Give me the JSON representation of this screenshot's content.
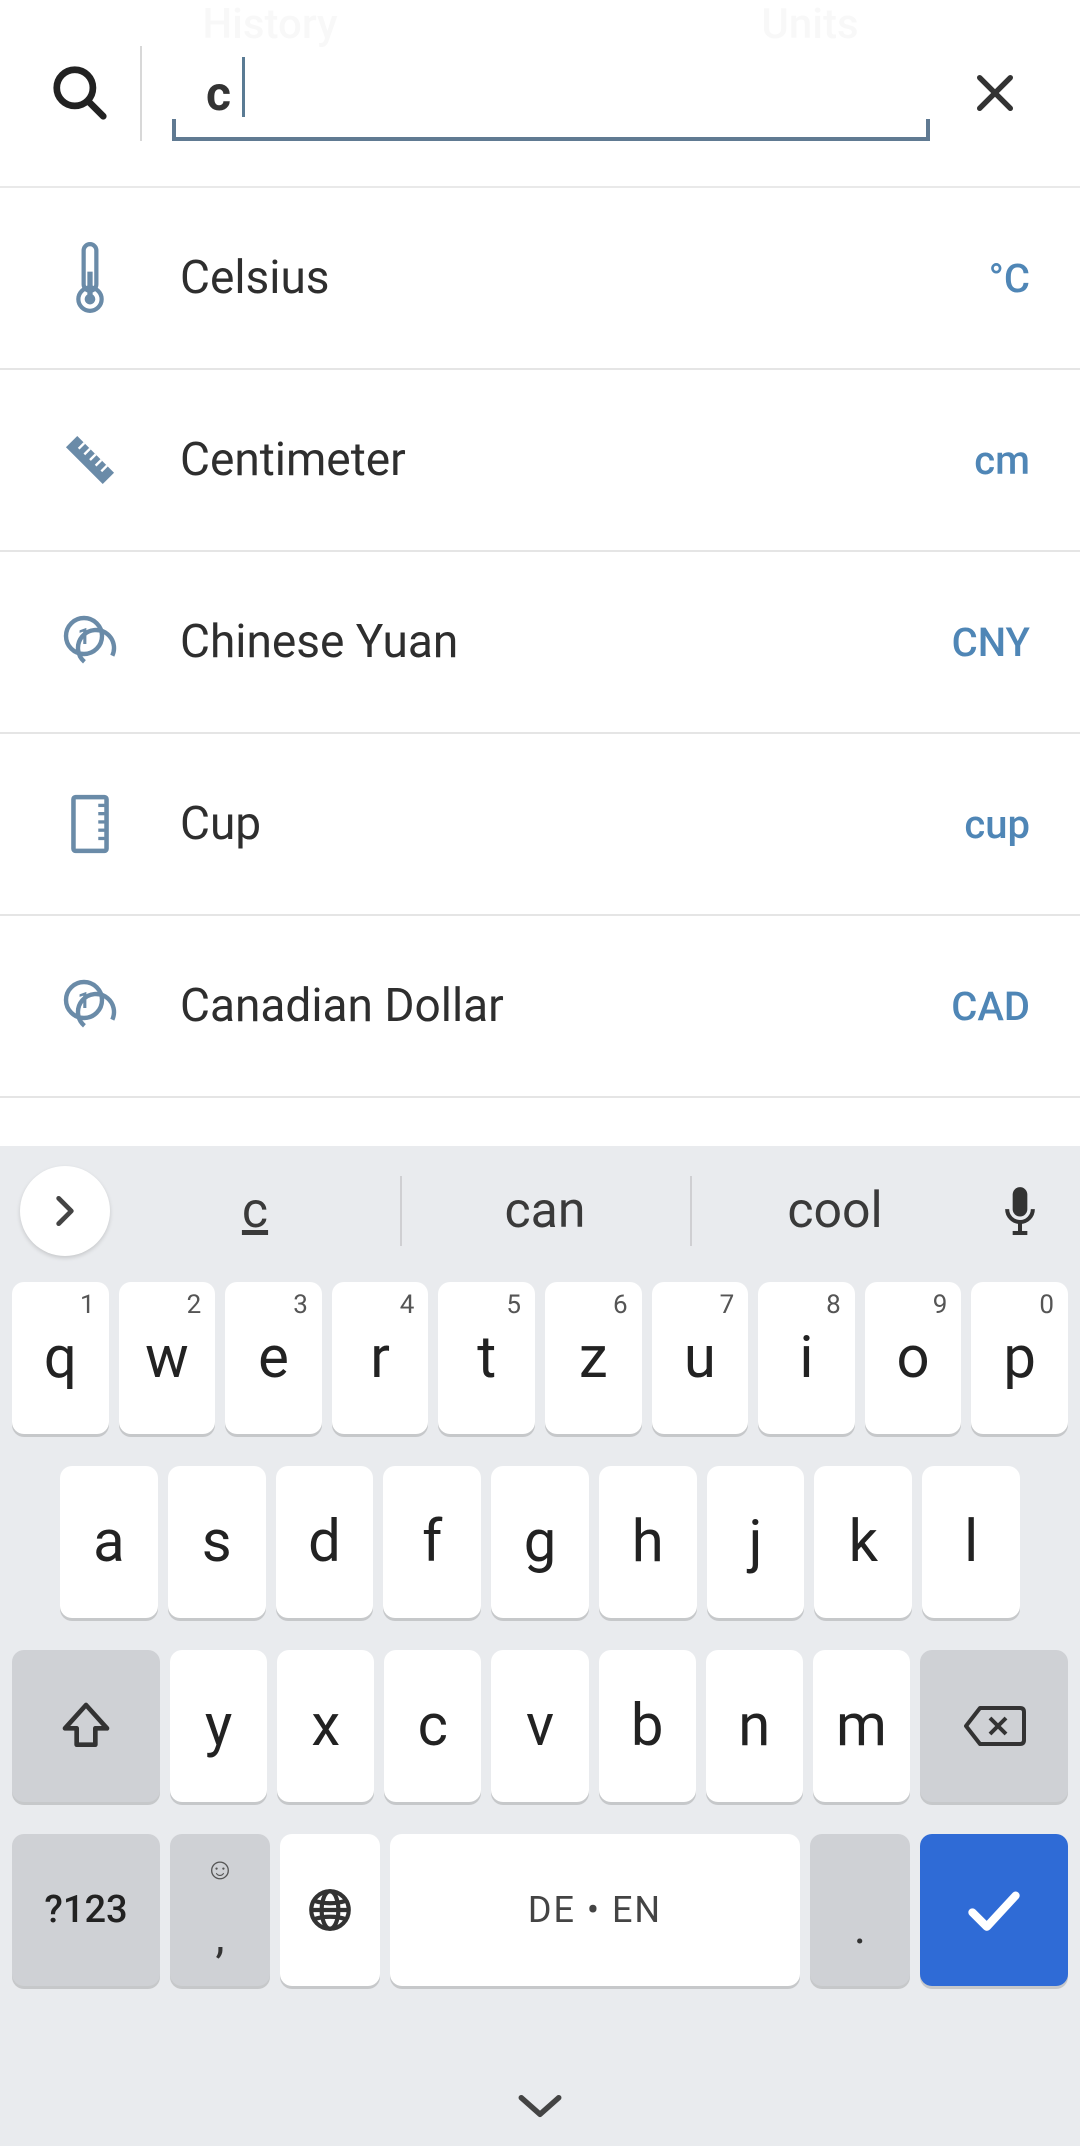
{
  "bg_tabs": {
    "left": "History",
    "right": "Units"
  },
  "search": {
    "value": "c"
  },
  "results": [
    {
      "icon": "thermometer",
      "name": "Celsius",
      "symbol": "°C"
    },
    {
      "icon": "ruler",
      "name": "Centimeter",
      "symbol": "cm"
    },
    {
      "icon": "coin",
      "name": "Chinese Yuan",
      "symbol": "CNY"
    },
    {
      "icon": "cup",
      "name": "Cup",
      "symbol": "cup"
    },
    {
      "icon": "coin",
      "name": "Canadian Dollar",
      "symbol": "CAD"
    }
  ],
  "suggestions": [
    "c",
    "can",
    "cool"
  ],
  "keyboard": {
    "row1": [
      {
        "k": "q",
        "n": "1"
      },
      {
        "k": "w",
        "n": "2"
      },
      {
        "k": "e",
        "n": "3"
      },
      {
        "k": "r",
        "n": "4"
      },
      {
        "k": "t",
        "n": "5"
      },
      {
        "k": "z",
        "n": "6"
      },
      {
        "k": "u",
        "n": "7"
      },
      {
        "k": "i",
        "n": "8"
      },
      {
        "k": "o",
        "n": "9"
      },
      {
        "k": "p",
        "n": "0"
      }
    ],
    "row2": [
      "a",
      "s",
      "d",
      "f",
      "g",
      "h",
      "j",
      "k",
      "l"
    ],
    "row3": [
      "y",
      "x",
      "c",
      "v",
      "b",
      "n",
      "m"
    ],
    "sym": "?123",
    "comma": ",",
    "emoji": "☺",
    "space": "DE • EN",
    "dot": "."
  }
}
